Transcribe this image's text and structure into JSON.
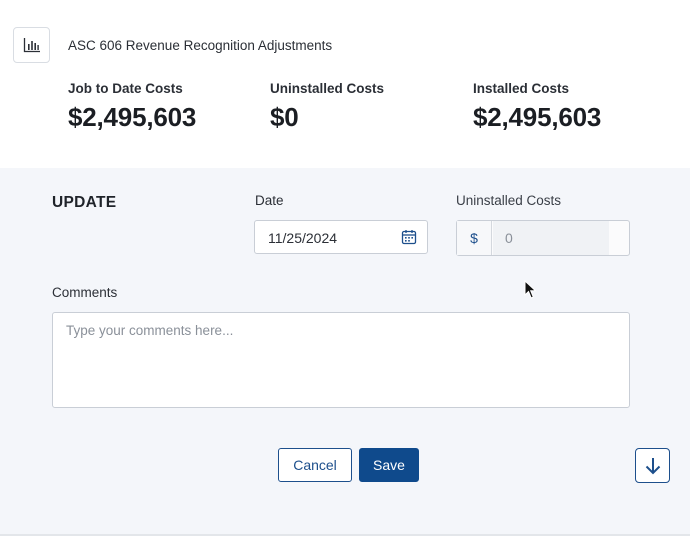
{
  "header": {
    "app_icon": "bar-chart-icon",
    "title": "ASC 606 Revenue Recognition Adjustments"
  },
  "metrics": [
    {
      "label": "Job to Date Costs",
      "value": "$2,495,603"
    },
    {
      "label": "Uninstalled Costs",
      "value": "$0"
    },
    {
      "label": "Installed Costs",
      "value": "$2,495,603"
    }
  ],
  "update": {
    "title": "UPDATE",
    "date_label": "Date",
    "date_value": "11/25/2024",
    "calendar_icon": "calendar-icon",
    "uninstalled_label": "Uninstalled Costs",
    "currency_symbol": "$",
    "uninstalled_value": "0",
    "comments_label": "Comments",
    "comments_placeholder": "Type your comments here..."
  },
  "actions": {
    "cancel_label": "Cancel",
    "save_label": "Save",
    "scroll_icon": "arrow-down-icon"
  },
  "colors": {
    "primary": "#0f4a8c",
    "background": "#f4f6fa",
    "panel": "#ffffff"
  }
}
